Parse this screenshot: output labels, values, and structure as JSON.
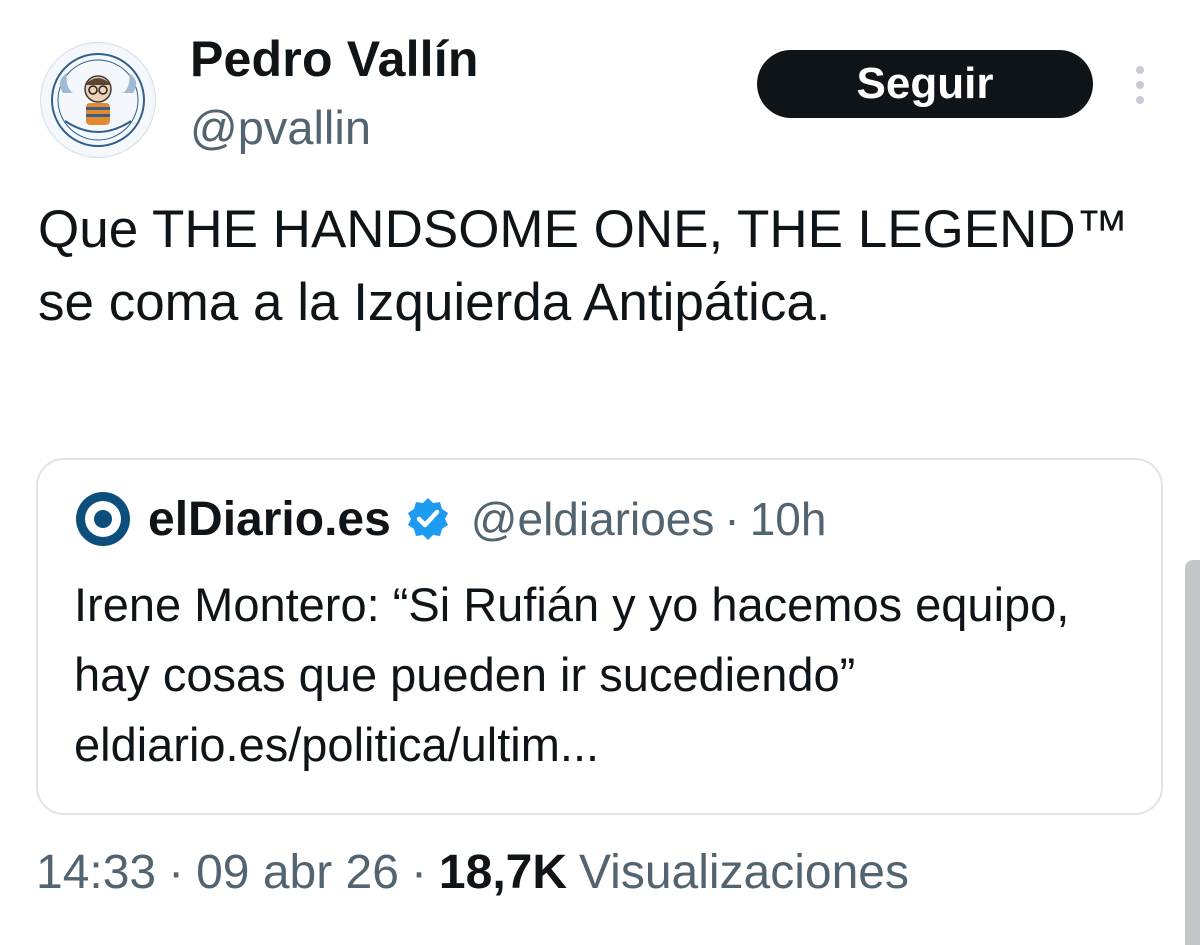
{
  "author": {
    "name": "Pedro Vallín",
    "handle": "@pvallin",
    "avatar_icon": "profile-caricature-seal-icon"
  },
  "follow_button": {
    "label": "Seguir"
  },
  "more_button": {
    "icon": "more-vertical-icon"
  },
  "tweet": {
    "text": "Que THE HANDSOME ONE, THE LEGEND™ se coma a la Izquierda Antipática."
  },
  "quoted_tweet": {
    "logo_icon": "eldiario-logo-icon",
    "name": "elDiario.es",
    "verified_icon": "verified-badge-icon",
    "handle": "@eldiarioes",
    "separator": "·",
    "time": "10h",
    "text": "Irene Montero: “Si Rufián y yo hacemos equipo, hay cosas que pueden ir sucediendo” eldiario.es/politica/ultim..."
  },
  "meta": {
    "time": "14:33",
    "separator": "·",
    "date": "09 abr 26",
    "views_count": "18,7K",
    "views_label": "Visualizaciones"
  },
  "colors": {
    "text_primary": "#0f1419",
    "text_secondary": "#536471",
    "verified_blue": "#1d9bf0",
    "button_bg": "#0f1419",
    "border": "#dfe4e8"
  }
}
